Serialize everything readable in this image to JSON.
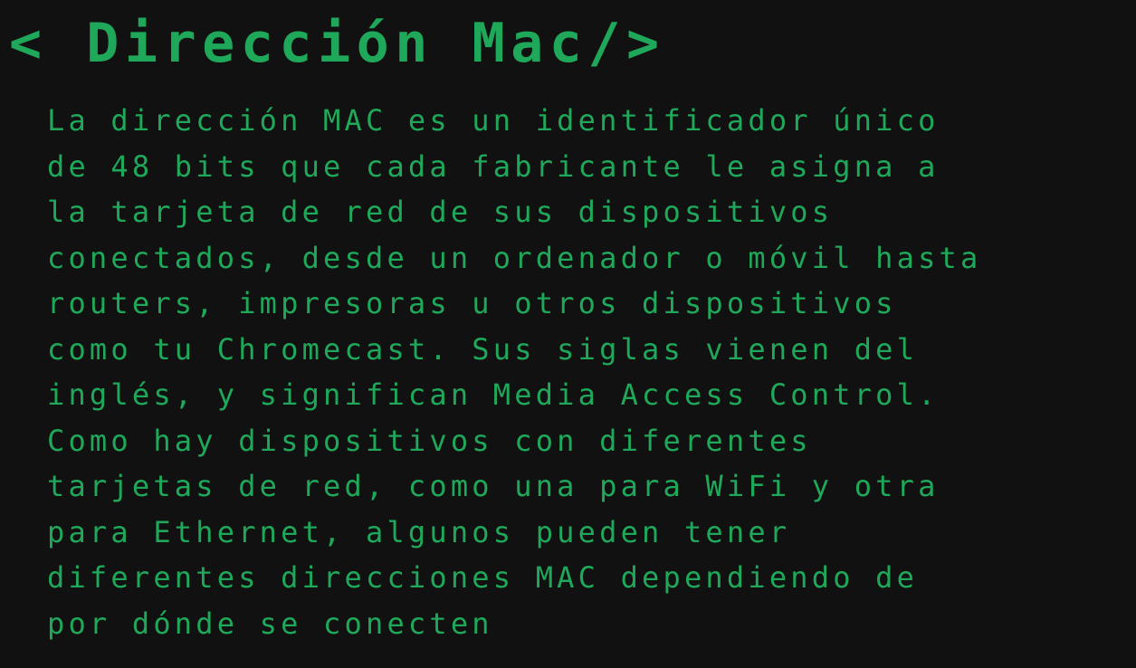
{
  "slide": {
    "title": "< Dirección Mac/>",
    "body_lines": [
      "La dirección MAC es un identificador único",
      "de 48 bits que cada fabricante le asigna a",
      "la tarjeta de red de sus dispositivos",
      "conectados, desde un ordenador o móvil hasta",
      "routers, impresoras u otros dispositivos",
      "como tu Chromecast. Sus siglas vienen del",
      "inglés, y significan Media Access Control.",
      "Como hay dispositivos con diferentes",
      "tarjetas de red, como una para WiFi y otra",
      "para Ethernet, algunos pueden tener",
      "diferentes direcciones MAC dependiendo de",
      "por dónde se conecten"
    ]
  },
  "colors": {
    "background": "#111111",
    "text": "#1fa85a"
  }
}
